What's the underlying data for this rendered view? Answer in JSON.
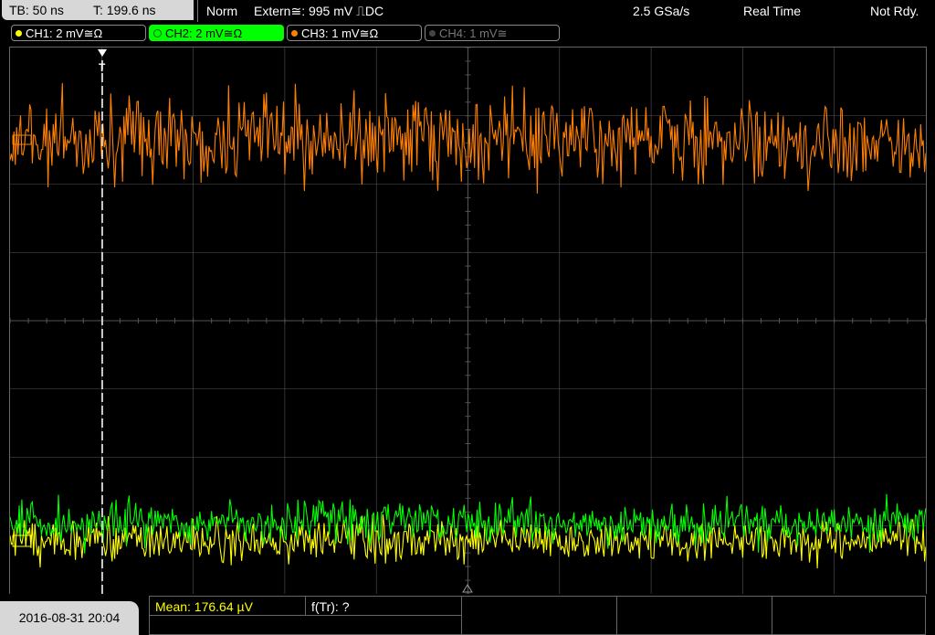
{
  "header": {
    "timebase": "TB: 50 ns",
    "trigger_time": "T: 199.6 ns",
    "trigger_mode": "Norm",
    "trigger_source": "Extern≅: 995 mV ⎍DC",
    "sample_rate": "2.5 GSa/s",
    "acq_mode": "Real Time",
    "status": "Not Rdy."
  },
  "channels": [
    {
      "label": "CH1: 2 mV≅Ω",
      "color": "#ffff00",
      "active": true
    },
    {
      "label": "CH2: 2 mV≅Ω",
      "color": "#00ff00",
      "active": true,
      "selected": true
    },
    {
      "label": "CH3: 1 mV≅Ω",
      "color": "#ff8000",
      "active": true
    },
    {
      "label": "CH4: 1 mV≅",
      "color": "#777777",
      "active": false
    }
  ],
  "screen": {
    "trigger_marker": "T"
  },
  "measurements": {
    "mean": "Mean: 176.64 µV",
    "freq": "f(Tr): ?"
  },
  "footer": {
    "datetime": "2016-08-31 20:04"
  },
  "colors": {
    "ch1": "#ffff00",
    "ch2": "#00ff00",
    "ch3": "#ff8000",
    "grid": "#555555",
    "panel": "#d7d7d7"
  }
}
